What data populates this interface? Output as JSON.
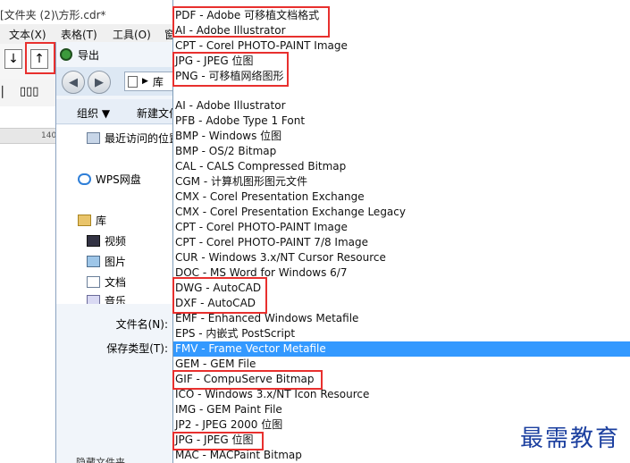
{
  "app": {
    "title": "[文件夹 (2)\\方形.cdr*",
    "menu": [
      "文本(X)",
      "表格(T)",
      "工具(O)",
      "窗"
    ],
    "ruler_tick": "140"
  },
  "dialog": {
    "title": "导出",
    "address": "库",
    "organize_label": "组织 ▼",
    "new_folder_label": "新建文件",
    "nav_items": [
      {
        "label": "最近访问的位置",
        "icon": "recent-places-icon"
      },
      {
        "label": "WPS网盘",
        "icon": "cloud-icon"
      },
      {
        "label": "库",
        "icon": "library-icon"
      },
      {
        "label": "视频",
        "icon": "video-icon"
      },
      {
        "label": "图片",
        "icon": "picture-icon"
      },
      {
        "label": "文档",
        "icon": "document-icon"
      },
      {
        "label": "音乐",
        "icon": "music-icon"
      }
    ],
    "filename_label": "文件名(N):",
    "filetype_label": "保存类型(T):",
    "bottom_partial": "隐藏文件夹"
  },
  "filetype_list": {
    "recent": [
      "PDF - Adobe 可移植文档格式",
      "AI - Adobe Illustrator",
      "CPT - Corel PHOTO-PAINT Image",
      "JPG - JPEG 位图",
      "PNG - 可移植网络图形"
    ],
    "all": [
      "AI - Adobe Illustrator",
      "PFB - Adobe Type 1 Font",
      "BMP - Windows 位图",
      "BMP - OS/2 Bitmap",
      "CAL - CALS Compressed Bitmap",
      "CGM - 计算机图形图元文件",
      "CMX - Corel Presentation Exchange",
      "CMX - Corel Presentation Exchange Legacy",
      "CPT - Corel PHOTO-PAINT Image",
      "CPT - Corel PHOTO-PAINT 7/8 Image",
      "CUR - Windows 3.x/NT Cursor Resource",
      "DOC - MS Word for Windows 6/7",
      "DWG - AutoCAD",
      "DXF - AutoCAD",
      "EMF - Enhanced Windows Metafile",
      "EPS - 内嵌式 PostScript",
      "FMV - Frame Vector Metafile",
      "GEM - GEM File",
      "GIF - CompuServe Bitmap",
      "ICO - Windows 3.x/NT Icon Resource",
      "IMG - GEM Paint File",
      "JP2 - JPEG 2000 位图",
      "JPG - JPEG 位图",
      "MAC - MACPaint Bitmap"
    ],
    "selected": "FMV - Frame Vector Metafile",
    "selected_color": "#3399ff",
    "highlight_color": "#e8302e"
  },
  "watermark": "最需教育"
}
